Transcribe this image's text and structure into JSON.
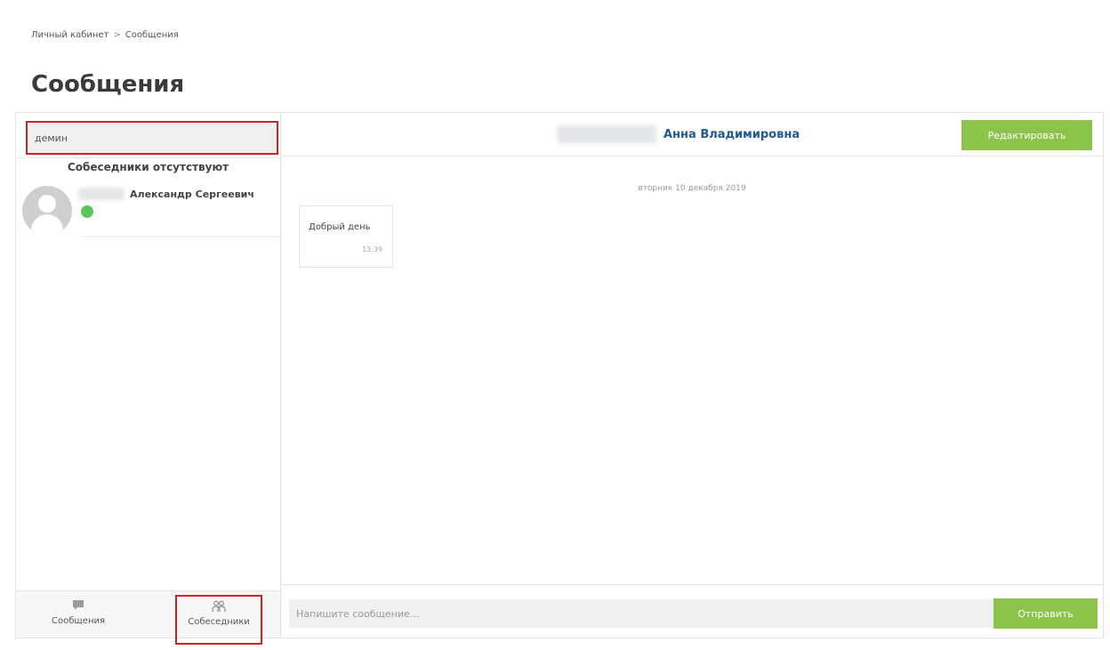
{
  "breadcrumb": {
    "home": "Личный кабинет",
    "separator": ">",
    "current": "Сообщения"
  },
  "page_title": "Сообщения",
  "search": {
    "value": "демин"
  },
  "contacts_panel": {
    "empty_text": "Собеседники отсутствуют",
    "contact": {
      "name": "Александр Сергеевич",
      "status": "online",
      "status_color": "#5cc45c"
    }
  },
  "tabs": [
    {
      "label": "Сообщения",
      "icon": "chat-bubble-icon"
    },
    {
      "label": "Собеседники",
      "icon": "people-icon"
    }
  ],
  "chat": {
    "contact_name": "Анна Владимировна",
    "edit_label": "Редактировать",
    "date_separator": "вторник 10 декабря 2019",
    "messages": [
      {
        "text": "Добрый день",
        "time": "13:39"
      }
    ],
    "compose_placeholder": "Напишите сообщение...",
    "send_label": "Отправить"
  },
  "colors": {
    "accent_green": "#8cc34a",
    "name_blue": "#1e5a96",
    "highlight_red": "#d0202a"
  }
}
